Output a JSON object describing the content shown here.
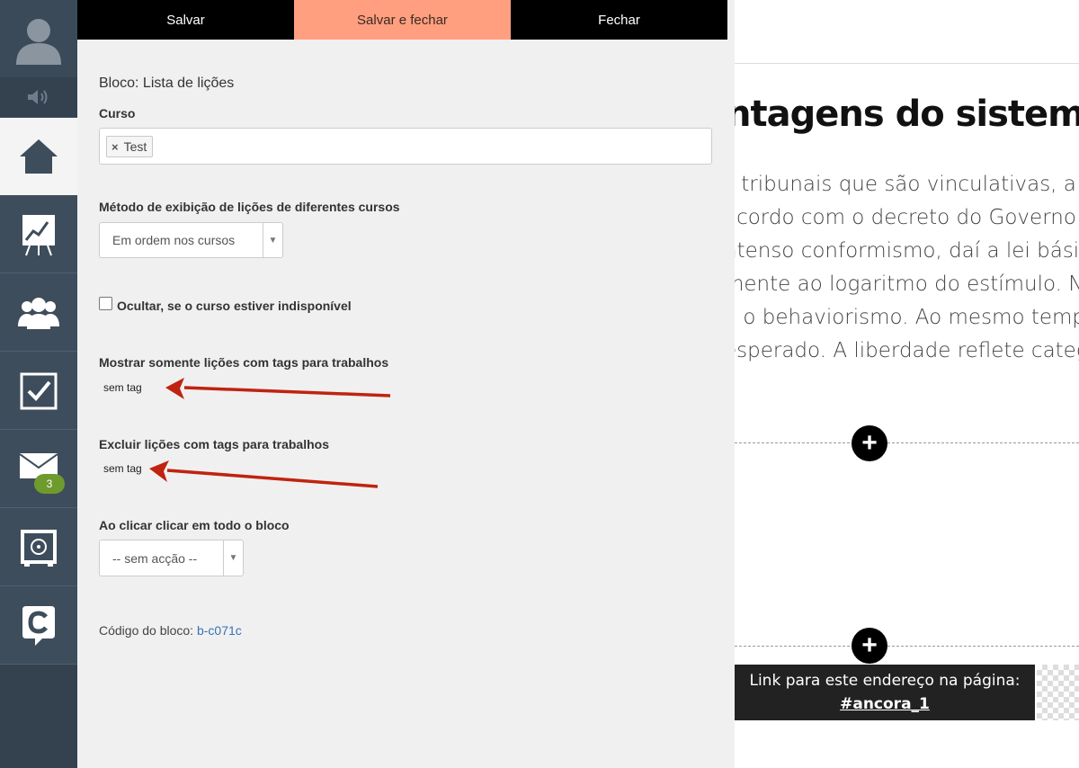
{
  "sidebar": {
    "items": [
      {
        "icon": "user-avatar-icon"
      },
      {
        "icon": "speaker-icon"
      },
      {
        "icon": "home-icon"
      },
      {
        "icon": "stats-chart-icon"
      },
      {
        "icon": "users-icon"
      },
      {
        "icon": "tasks-check-icon"
      },
      {
        "icon": "mail-icon",
        "badge": "3"
      },
      {
        "icon": "safe-icon"
      },
      {
        "icon": "brand-c-icon"
      }
    ],
    "colors": {
      "bg": "#3e4d5c",
      "active_bg": "#f4f4f4",
      "badge": "#6f9a2e"
    }
  },
  "toolbar": {
    "save_label": "Salvar",
    "save_close_label": "Salvar e fechar",
    "close_label": "Fechar",
    "accent_color": "#ff9f7f"
  },
  "form": {
    "block_title": "Bloco: Lista de lições",
    "course_label": "Curso",
    "course_tags": [
      "Test"
    ],
    "display_method_label": "Método de exibição de lições de diferentes cursos",
    "display_method_value": "Em ordem nos cursos",
    "hide_label": "Ocultar, se o curso estiver indisponível",
    "hide_checked": false,
    "show_only_label": "Mostrar somente lições com tags para trabalhos",
    "show_only_value": "sem tag",
    "exclude_label": "Excluir lições com tags para trabalhos",
    "exclude_value": "sem tag",
    "click_label": "Ao clicar clicar em todo o bloco",
    "click_value": "-- sem acção --",
    "code_label": "Código do bloco:",
    "code_value": "b-c071c"
  },
  "preview": {
    "heading": "ntagens do sistema",
    "paragraph_lines": [
      "s tribunais que são vinculativas, a co",
      "acordo com o decreto do Governo",
      "ntenso conformismo, daí a lei básic",
      "mente ao logaritmo do estímulo. N",
      "a o behaviorismo. Ao mesmo tempo",
      "esperado. A liberdade reflete catego"
    ],
    "anchor_text": "Link para este endereço na página:",
    "anchor_id": "#ancora_1"
  },
  "annotation_color": "#c0230f"
}
